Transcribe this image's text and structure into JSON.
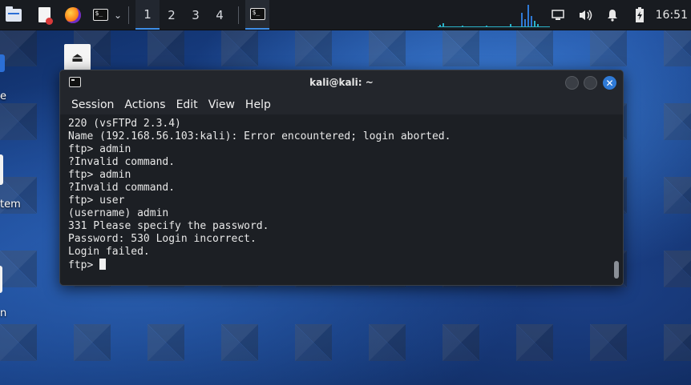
{
  "taskbar": {
    "workspaces": [
      "1",
      "2",
      "3",
      "4"
    ],
    "active_workspace": "1",
    "clock": "16:51",
    "icons": [
      "files-icon",
      "document-icon",
      "firefox-icon",
      "terminal-icon",
      "chevron-down-icon",
      "terminal-task-icon",
      "network-graph",
      "network-icon",
      "volume-icon",
      "notification-bell-icon",
      "battery-icon"
    ]
  },
  "desktop": {
    "labels": [
      "e",
      "tem",
      "n"
    ]
  },
  "terminal": {
    "title": "kali@kali: ~",
    "menu": [
      "Session",
      "Actions",
      "Edit",
      "View",
      "Help"
    ],
    "lines": [
      "220 (vsFTPd 2.3.4)",
      "Name (192.168.56.103:kali): Error encountered; login aborted.",
      "ftp> admin",
      "?Invalid command.",
      "ftp> admin",
      "?Invalid command.",
      "ftp> user",
      "(username) admin",
      "331 Please specify the password.",
      "Password: 530 Login incorrect.",
      "Login failed."
    ],
    "prompt": "ftp> "
  },
  "colors": {
    "accent": "#3d8ee8",
    "close_button": "#2f7ad6",
    "terminal_bg": "#1c1f24"
  }
}
